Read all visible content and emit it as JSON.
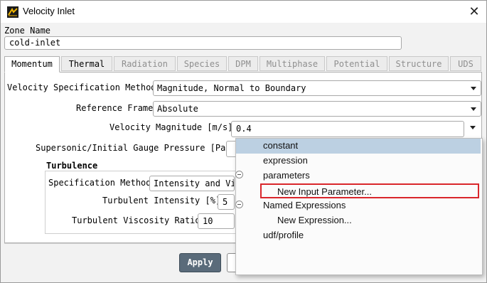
{
  "window": {
    "title": "Velocity Inlet",
    "close_glyph": "✕"
  },
  "zone": {
    "label": "Zone Name",
    "value": "cold-inlet"
  },
  "tabs": [
    {
      "label": "Momentum",
      "state": "active"
    },
    {
      "label": "Thermal",
      "state": "normal"
    },
    {
      "label": "Radiation",
      "state": "disabled"
    },
    {
      "label": "Species",
      "state": "disabled"
    },
    {
      "label": "DPM",
      "state": "disabled"
    },
    {
      "label": "Multiphase",
      "state": "disabled"
    },
    {
      "label": "Potential",
      "state": "disabled"
    },
    {
      "label": "Structure",
      "state": "disabled"
    },
    {
      "label": "UDS",
      "state": "disabled"
    }
  ],
  "momentum": {
    "velocity_spec_label": "Velocity Specification Method",
    "velocity_spec_value": "Magnitude, Normal to Boundary",
    "reference_frame_label": "Reference Frame",
    "reference_frame_value": "Absolute",
    "velocity_magnitude_label": "Velocity Magnitude [m/s]",
    "velocity_magnitude_value": "0.4",
    "gauge_pressure_label": "Supersonic/Initial Gauge Pressure [Pa]",
    "gauge_pressure_value": ""
  },
  "turbulence": {
    "title": "Turbulence",
    "spec_method_label": "Specification Method",
    "spec_method_value": "Intensity and Vi",
    "intensity_label": "Turbulent Intensity [%]",
    "intensity_value": "5",
    "viscosity_ratio_label": "Turbulent Viscosity Ratio",
    "viscosity_ratio_value": "10"
  },
  "buttons": {
    "apply": "Apply"
  },
  "dropdown_menu": {
    "items": [
      {
        "label": "constant",
        "highlighted": true
      },
      {
        "label": "expression"
      },
      {
        "label": "parameters"
      },
      {
        "label": "New Input Parameter...",
        "boxed": true
      },
      {
        "label": "Named Expressions"
      },
      {
        "label": "New Expression..."
      },
      {
        "label": "udf/profile"
      }
    ]
  },
  "colors": {
    "highlight": "#bcd0e2",
    "boxed_border": "#d9262b",
    "apply_button": "#5a6b7a"
  }
}
